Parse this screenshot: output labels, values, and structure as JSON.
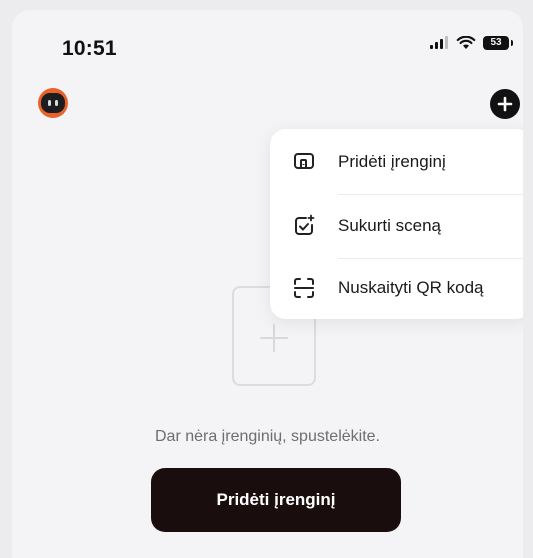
{
  "status_bar": {
    "time": "10:51",
    "battery": "53"
  },
  "header": {
    "avatar_icon": "robot-avatar-icon",
    "add_icon": "plus-circle-icon"
  },
  "menu": {
    "items": [
      {
        "label": "Pridėti įrenginį",
        "icon": "add-device-icon"
      },
      {
        "label": "Sukurti sceną",
        "icon": "create-scene-icon"
      },
      {
        "label": "Nuskaityti QR kodą",
        "icon": "scan-qr-icon"
      }
    ]
  },
  "empty_state": {
    "icon": "add-placeholder-icon",
    "message": "Dar nėra įrenginių, spustelėkite.",
    "button_label": "Pridėti įrenginį"
  },
  "colors": {
    "accent_orange": "#e8622b",
    "button_dark": "#1a0d0d",
    "background": "#f4f4f6"
  }
}
